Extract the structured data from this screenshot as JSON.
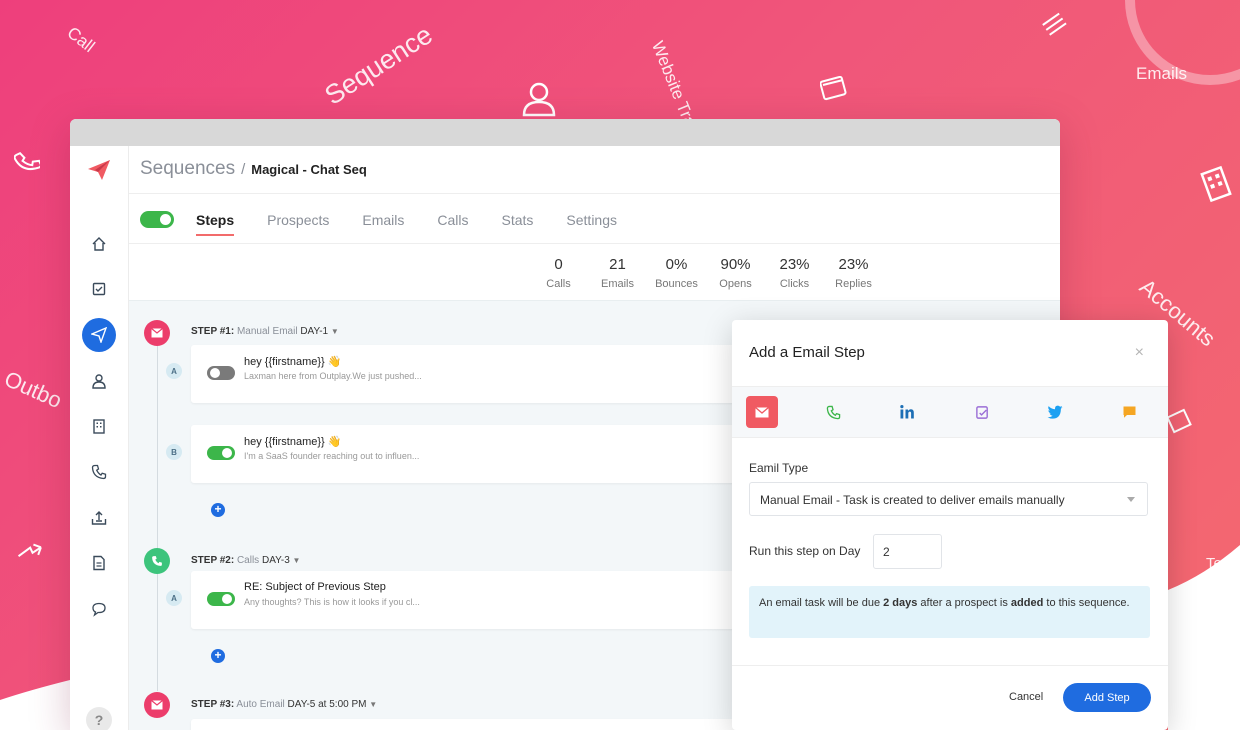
{
  "background": {
    "words": [
      "Call",
      "Sequence",
      "Website Tra",
      "Emails",
      "Accounts",
      "Outbo",
      "Ter"
    ],
    "colors": {
      "gradient_start": "#ee3f7c",
      "gradient_end": "#f46a6f"
    }
  },
  "header": {
    "breadcrumb_root": "Sequences",
    "breadcrumb_separator": "/",
    "breadcrumb_current": "Magical - Chat Seq"
  },
  "tabs": [
    "Steps",
    "Prospects",
    "Emails",
    "Calls",
    "Stats",
    "Settings"
  ],
  "stats": [
    {
      "value": "0",
      "label": "Calls"
    },
    {
      "value": "21",
      "label": "Emails"
    },
    {
      "value": "0%",
      "label": "Bounces"
    },
    {
      "value": "90%",
      "label": "Opens"
    },
    {
      "value": "23%",
      "label": "Clicks"
    },
    {
      "value": "23%",
      "label": "Replies"
    }
  ],
  "steps": [
    {
      "number": "STEP #1:",
      "type": "Manual Email",
      "day": "DAY-1",
      "variants": [
        {
          "letter": "A",
          "enabled": false,
          "subject": "hey {{firstname}} 👋",
          "preview": "Laxman here from Outplay.We just pushed..."
        },
        {
          "letter": "B",
          "enabled": true,
          "subject": "hey {{firstname}} 👋",
          "preview": "I'm a SaaS founder reaching out to influen..."
        }
      ]
    },
    {
      "number": "STEP #2:",
      "type": "Calls",
      "day": "DAY-3",
      "variants": [
        {
          "letter": "A",
          "enabled": true,
          "subject": "RE: Subject of Previous Step",
          "preview": "Any thoughts? This is how it looks if you cl..."
        }
      ]
    },
    {
      "number": "STEP #3:",
      "type": "Auto Email",
      "day": "DAY-5 at 5:00 PM",
      "variants": []
    }
  ],
  "sidebar": {
    "icons": [
      "home-icon",
      "tasks-icon",
      "sequences-icon",
      "prospects-icon",
      "accounts-icon",
      "calls-icon",
      "inbox-icon",
      "templates-icon",
      "chat-icon"
    ],
    "help_label": "?"
  },
  "modal": {
    "title": "Add a Email Step",
    "close": "×",
    "step_types": [
      "email-icon",
      "phone-icon",
      "linkedin-icon",
      "task-icon",
      "twitter-icon",
      "sms-icon"
    ],
    "type_label": "Eamil Type",
    "type_value": "Manual Email - Task is created to deliver emails manually",
    "day_label": "Run this step on Day",
    "day_value": "2",
    "info_pre": "An email task will be due ",
    "info_days": "2 days",
    "info_mid": " after a prospect is ",
    "info_added": "added",
    "info_post": " to this sequence.",
    "cancel_label": "Cancel",
    "add_label": "Add Step"
  },
  "colors": {
    "primary": "#1f6ce0",
    "success": "#3cb64a",
    "email_step": "#ec3d6b",
    "call_step": "#3cc47c",
    "accent_tab": "#f26b6b"
  }
}
